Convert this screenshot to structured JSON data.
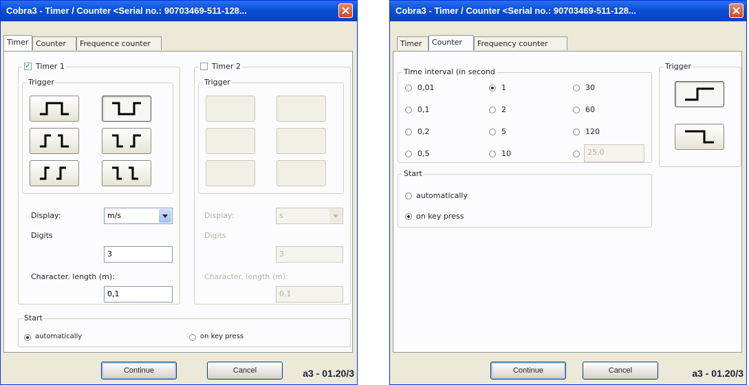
{
  "left": {
    "title": "Cobra3 - Timer / Counter   <Serial no.: 90703469-511-128...",
    "tabs": [
      "Timer",
      "Counter",
      "Frequence counter"
    ],
    "timer1": {
      "label": "Timer 1",
      "checked": true,
      "trigger_label": "Trigger",
      "display_label": "Display:",
      "display_value": "m/s",
      "digits_label": "Digits",
      "digits_value": "3",
      "char_length_label": "Character. length (m):",
      "char_length_value": "0,1"
    },
    "timer2": {
      "label": "Timer 2",
      "checked": false,
      "trigger_label": "Trigger",
      "display_label": "Display:",
      "display_value": "s",
      "digits_label": "Digits",
      "digits_value": "3",
      "char_length_label": "Character. length (m):",
      "char_length_value": "0,1"
    },
    "start": {
      "legend": "Start",
      "auto": "automatically",
      "keypress": "on key press",
      "selected": "automatically"
    },
    "continue": "Continue",
    "cancel": "Cancel",
    "version": "a3 - 01.20/3"
  },
  "right": {
    "title": "Cobra3 - Timer / Counter   <Serial no.: 90703469-511-128...",
    "tabs": [
      "Timer",
      "Counter",
      "Frequency counter"
    ],
    "interval": {
      "legend": "Time interval (in second",
      "options": [
        "0,01",
        "1",
        "30",
        "0,1",
        "2",
        "60",
        "0,2",
        "5",
        "120",
        "0,5",
        "10"
      ],
      "selected": "1",
      "custom_value": "25,0"
    },
    "trigger_label": "Trigger",
    "start": {
      "legend": "Start",
      "auto": "automatically",
      "keypress": "on key press",
      "selected": "on key press"
    },
    "continue": "Continue",
    "cancel": "Cancel",
    "version": "a3 - 01.20/3"
  }
}
